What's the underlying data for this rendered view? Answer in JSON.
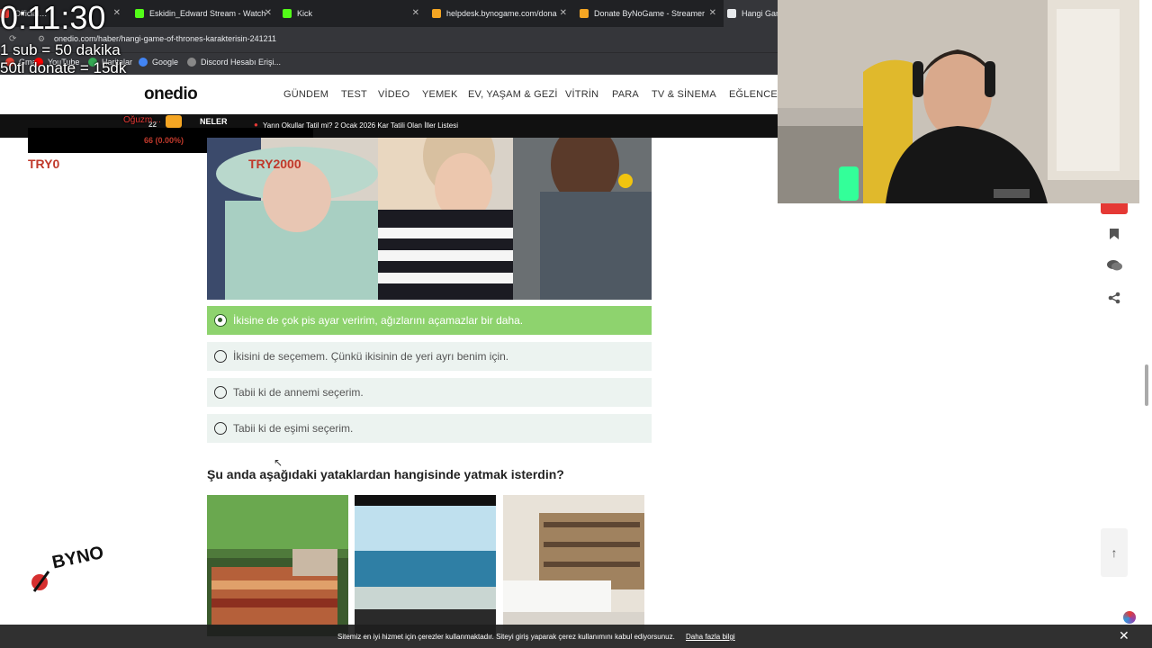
{
  "browser": {
    "tabs": [
      {
        "label": "Official…",
        "color": "#e53935"
      },
      {
        "label": "Eskidin_Edward Stream - Watch",
        "color": "#53fc18"
      },
      {
        "label": "Kick",
        "color": "#53fc18"
      },
      {
        "label": "helpdesk.bynogame.com/dona",
        "color": "#f5a623"
      },
      {
        "label": "Donate ByNoGame - Streamer",
        "color": "#f5a623"
      },
      {
        "label": "Hangi Gam",
        "color": "#e8eaed"
      }
    ],
    "url": "onedio.com/haber/hangi-game-of-thrones-karakterisin-241211",
    "bookmarks": [
      {
        "label": "Gmail"
      },
      {
        "label": "YouTube"
      },
      {
        "label": "Haritalar"
      },
      {
        "label": "Google"
      },
      {
        "label": "Discord Hesabı Erişi..."
      }
    ]
  },
  "overlay": {
    "timer": "0:11:30",
    "sub_rule": "1 sub = 50 dakika",
    "donate_rule": "50tl donate = 15dk",
    "try_left": "TRY0",
    "try_right": "TRY2000",
    "goal_text": "66 (0.00%)",
    "alert_name": "Oğuzm…",
    "byno_logo": "BYNO"
  },
  "site": {
    "logo": "onedio",
    "nav": [
      "GÜNDEM",
      "TEST",
      "VİDEO",
      "YEMEK",
      "EV, YAŞAM & GEZİ",
      "VİTRİN",
      "PARA",
      "TV & SİNEMA",
      "EĞLENCE"
    ],
    "ticker_label": "NELER",
    "ticker": "Yarın Okullar Tatil mi? 2 Ocak 2026 Kar Tatili Olan İller Listesi"
  },
  "quiz": {
    "options": [
      {
        "text": "İkisine de çok pis ayar veririm, ağızlarını açamazlar bir daha.",
        "selected": true
      },
      {
        "text": "İkisini de seçemem. Çünkü ikisinin de yeri ayrı benim için.",
        "selected": false
      },
      {
        "text": "Tabii ki de annemi seçerim.",
        "selected": false
      },
      {
        "text": "Tabii ki de eşimi seçerim.",
        "selected": false
      }
    ],
    "question2": "Şu anda aşağıdaki yataklardan hangisinde yatmak isterdin?"
  },
  "cookie": {
    "text": "Sitemiz en iyi hizmet için çerezler kullanmaktadır. Siteyi giriş yaparak çerez kullanımını kabul ediyorsunuz.",
    "link": "Daha fazla bilgi",
    "close": "✕"
  },
  "colors": {
    "selected": "#8ed36e",
    "option_bg": "#ecf3f0",
    "try_red": "#c0392b"
  }
}
